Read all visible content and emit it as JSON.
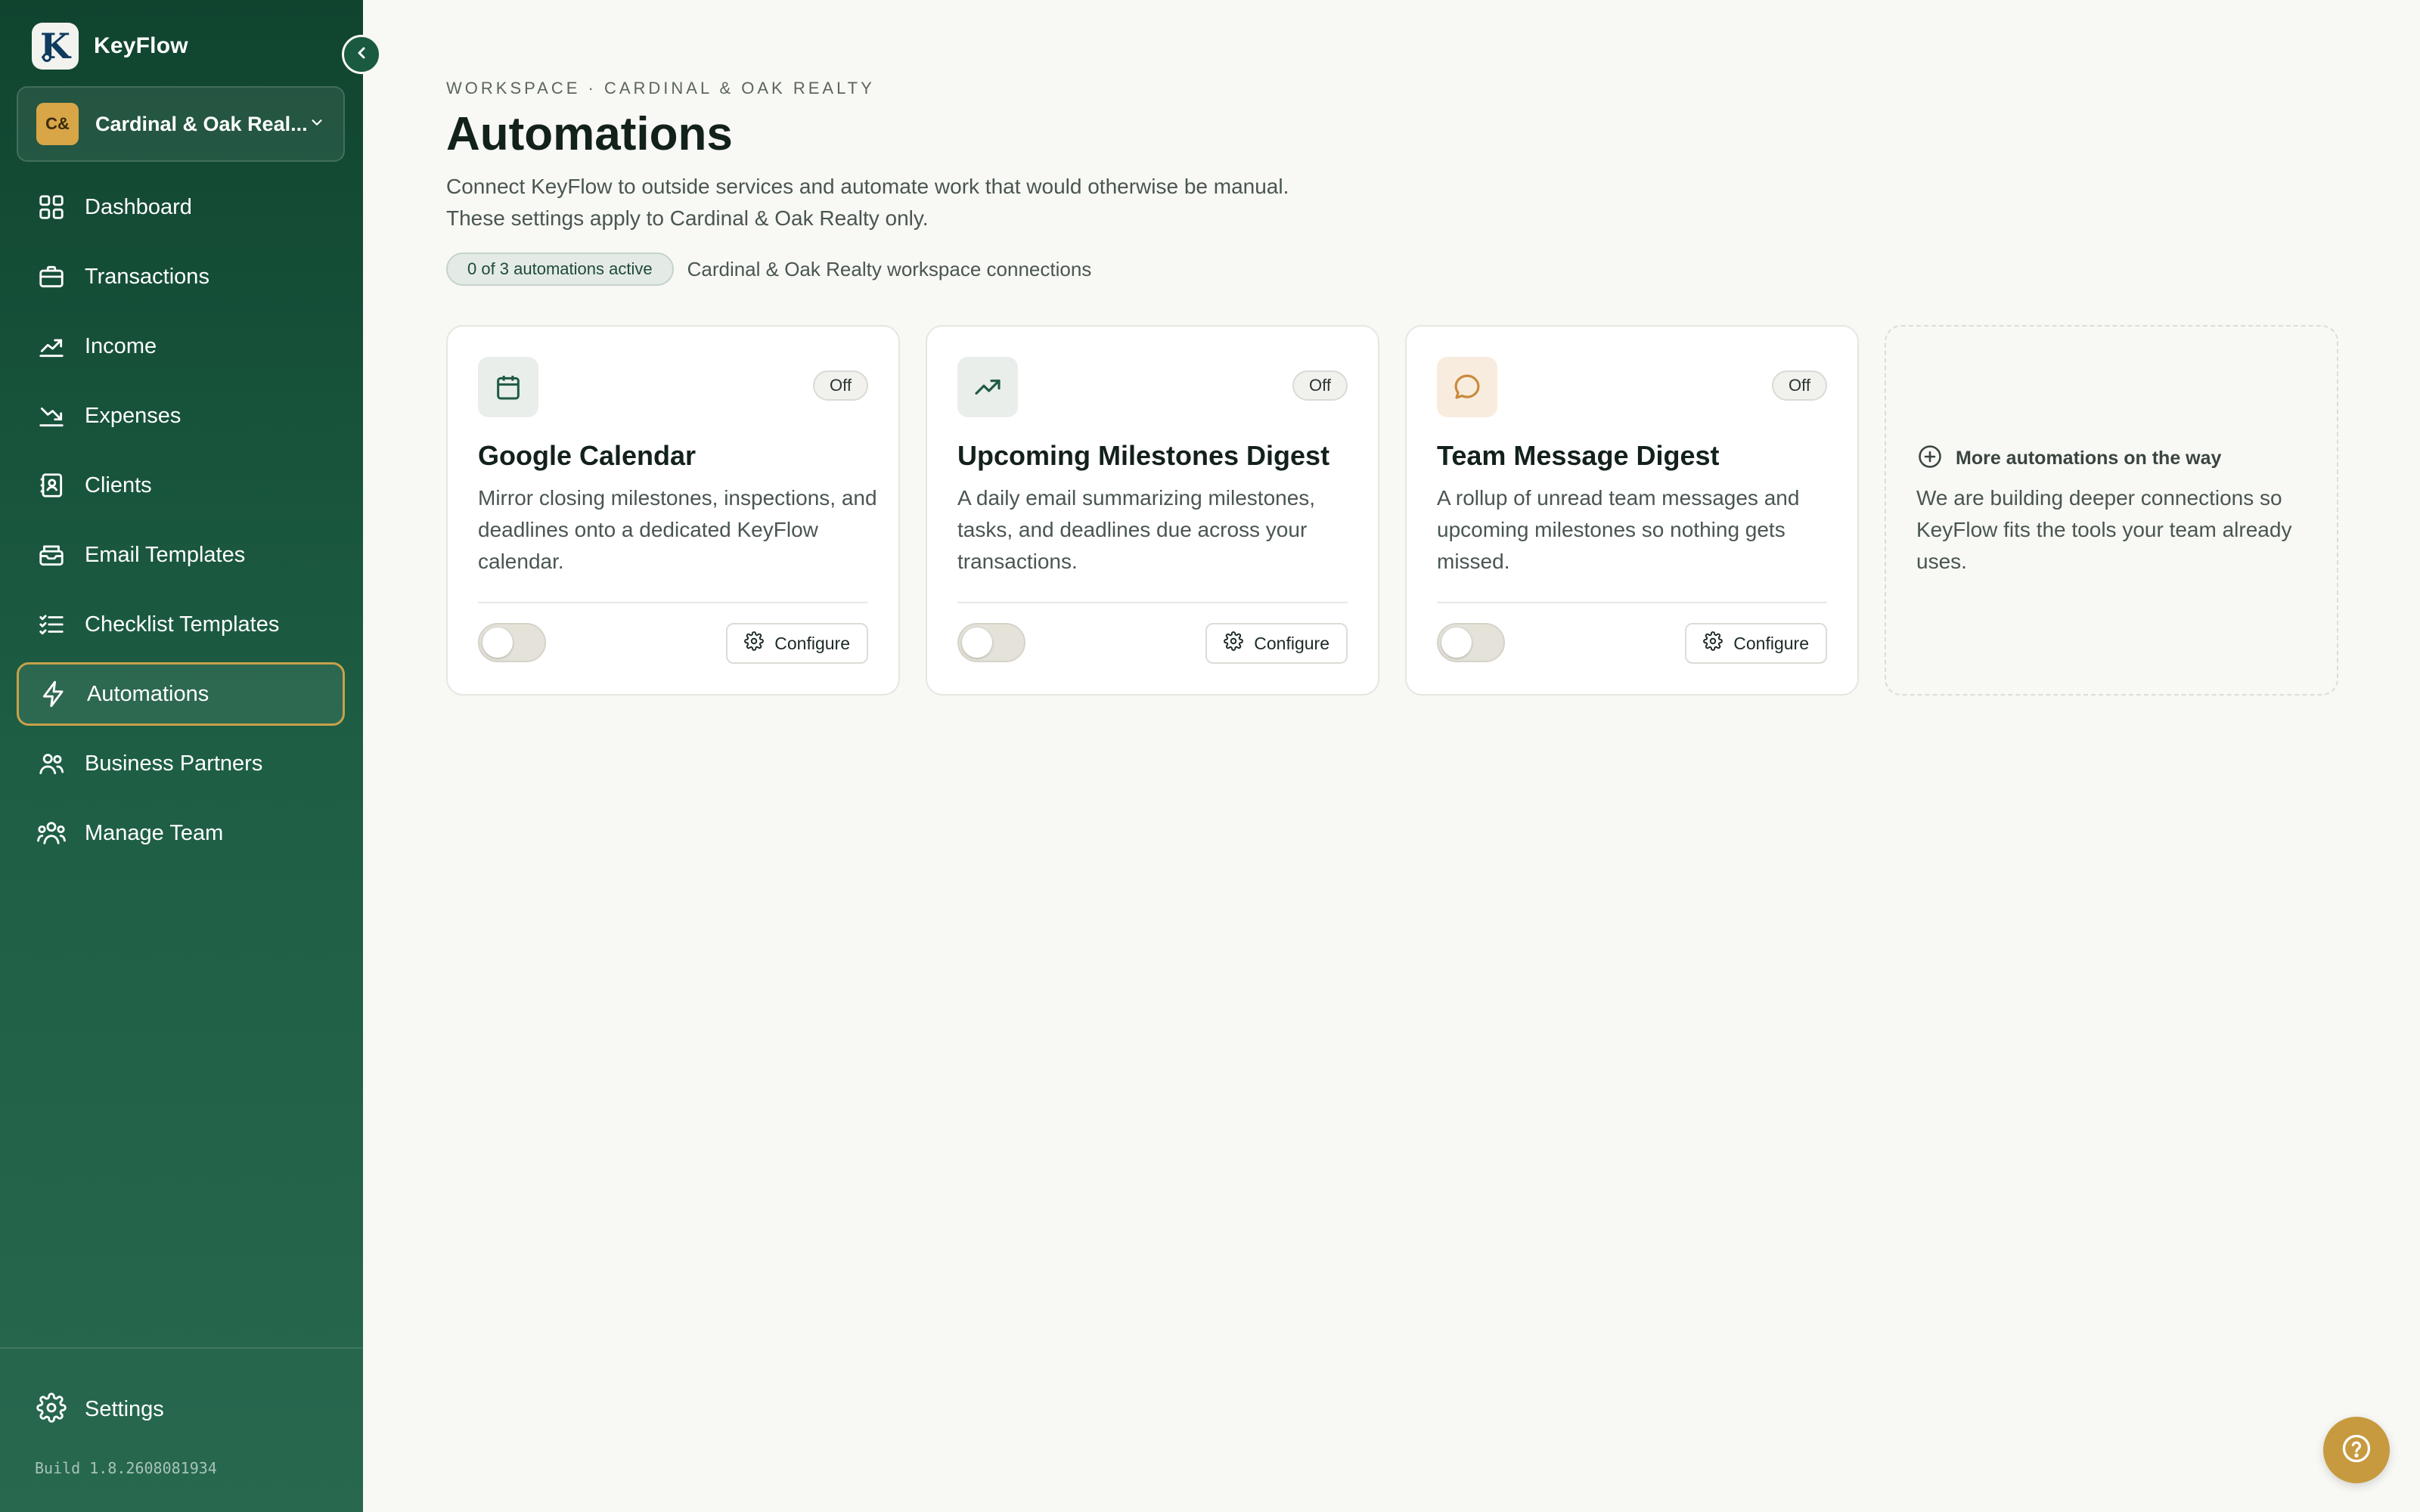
{
  "app": {
    "name": "KeyFlow",
    "logo_letter": "K"
  },
  "workspace": {
    "initials": "C&",
    "name": "Cardinal & Oak Real..."
  },
  "sidebar": {
    "items": [
      {
        "label": "Dashboard",
        "icon": "grid-icon"
      },
      {
        "label": "Transactions",
        "icon": "briefcase-icon"
      },
      {
        "label": "Income",
        "icon": "trending-up-icon"
      },
      {
        "label": "Expenses",
        "icon": "trending-down-icon"
      },
      {
        "label": "Clients",
        "icon": "contacts-icon"
      },
      {
        "label": "Email Templates",
        "icon": "inbox-icon"
      },
      {
        "label": "Checklist Templates",
        "icon": "checklist-icon"
      },
      {
        "label": "Automations",
        "icon": "lightning-icon",
        "active": true
      },
      {
        "label": "Business Partners",
        "icon": "users-icon"
      },
      {
        "label": "Manage Team",
        "icon": "team-icon"
      }
    ],
    "settings_label": "Settings",
    "build": "Build 1.8.2608081934"
  },
  "header": {
    "eyebrow": "WORKSPACE · CARDINAL & OAK REALTY",
    "title": "Automations",
    "description_line1": "Connect KeyFlow to outside services and automate work that would otherwise be manual.",
    "description_line2": "These settings apply to Cardinal & Oak Realty only.",
    "badge": "0 of 3 automations active",
    "status_text": "Cardinal & Oak Realty workspace connections"
  },
  "cards": [
    {
      "title": "Google Calendar",
      "description": "Mirror closing milestones, inspections, and deadlines onto a dedicated KeyFlow calendar.",
      "status": "Off",
      "configure_label": "Configure",
      "enabled": false,
      "icon": "calendar-icon"
    },
    {
      "title": "Upcoming Milestones Digest",
      "description": "A daily email summarizing milestones, tasks, and deadlines due across your transactions.",
      "status": "Off",
      "configure_label": "Configure",
      "enabled": false,
      "icon": "trending-up-icon"
    },
    {
      "title": "Team Message Digest",
      "description": "A rollup of unread team messages and upcoming milestones so nothing gets missed.",
      "status": "Off",
      "configure_label": "Configure",
      "enabled": false,
      "icon": "chat-bubble-icon"
    }
  ],
  "more_card": {
    "title": "More automations on the way",
    "description": "We are building deeper connections so KeyFlow fits the tools your team already uses."
  },
  "colors": {
    "sidebar_top": "#10442f",
    "sidebar_bottom": "#27684f",
    "accent_gold": "#c7a14b",
    "help_button": "#c79a3f"
  }
}
